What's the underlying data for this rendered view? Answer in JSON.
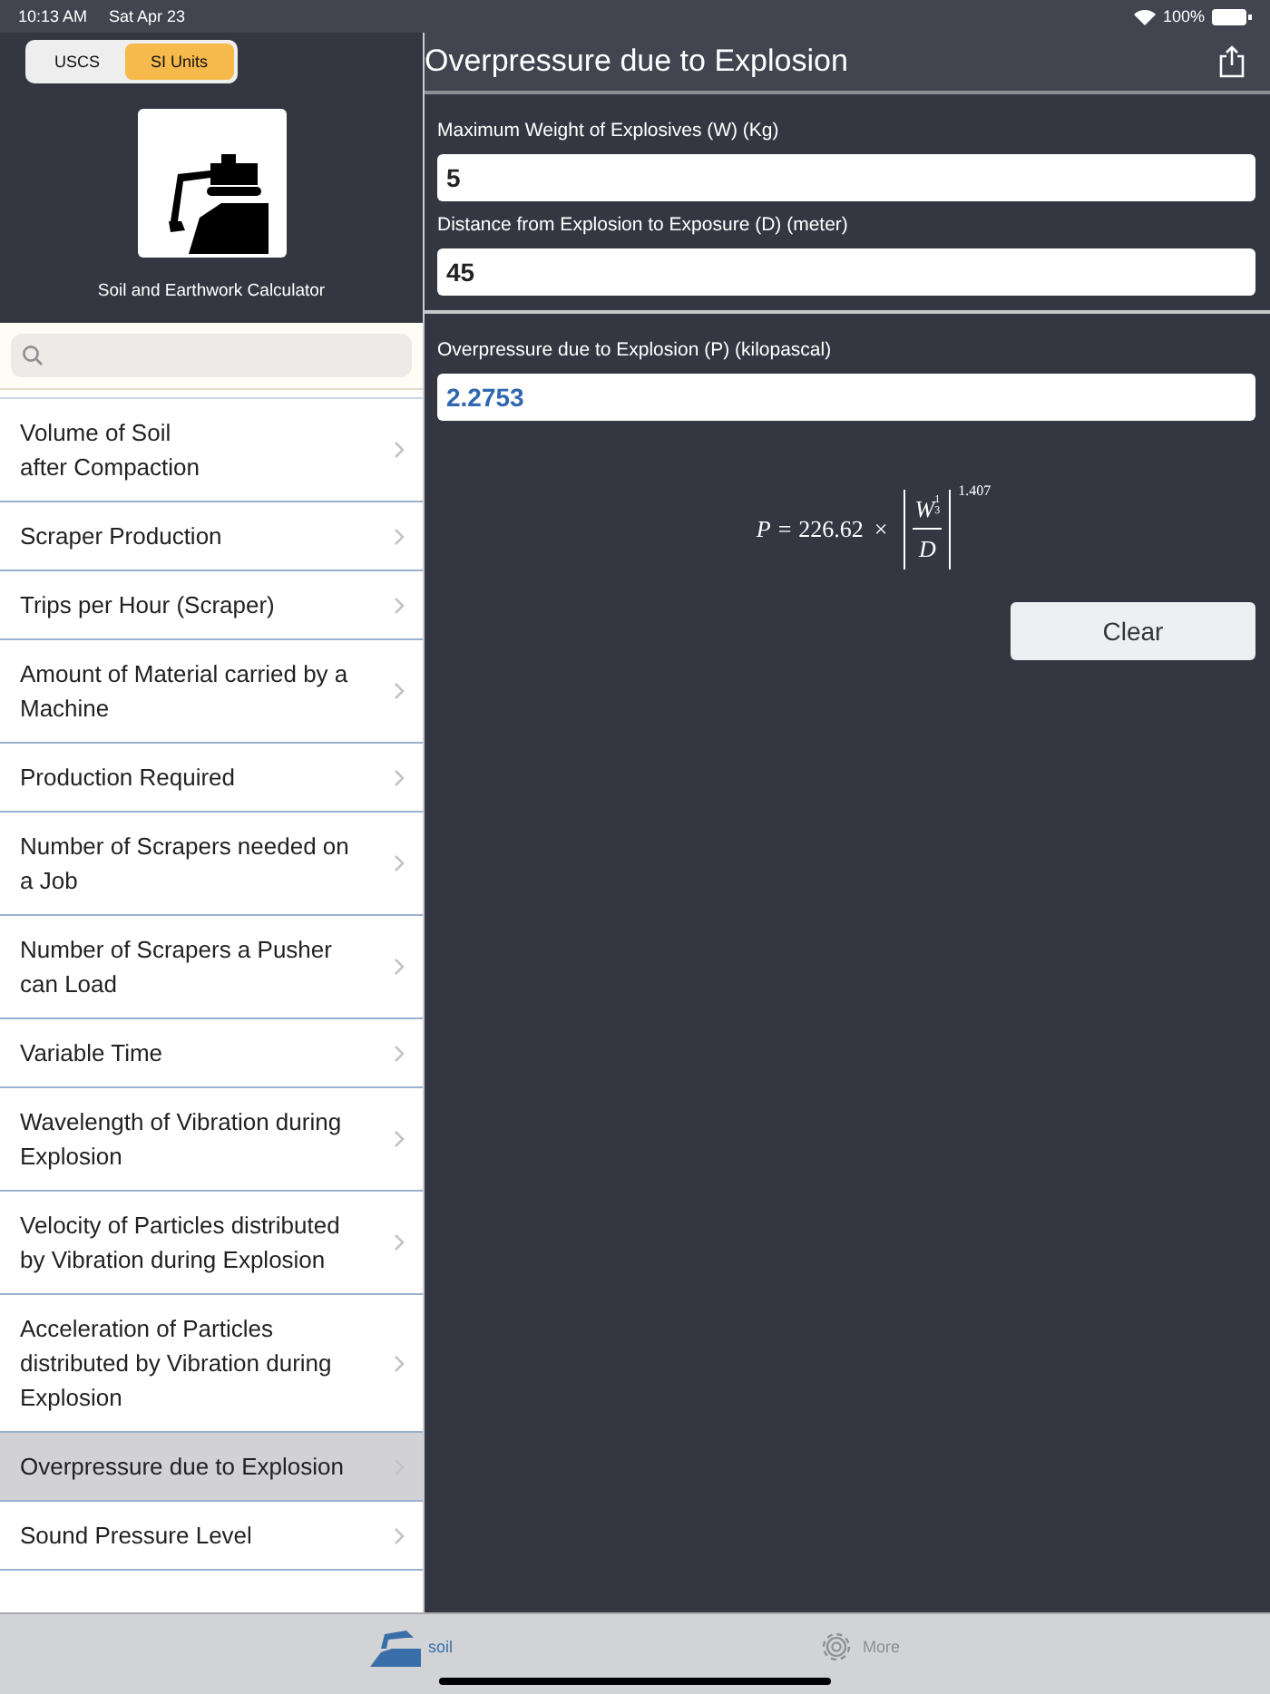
{
  "status_bar": {
    "time": "10:13 AM",
    "date": "Sat Apr 23",
    "battery_text": "100%"
  },
  "unit_toggle": [
    {
      "label": "USCS",
      "selected": false
    },
    {
      "label": "SI Units",
      "selected": true
    }
  ],
  "sidebar": {
    "app_name": "Soil and Earthwork Calculator",
    "items": [
      {
        "label": "Volume of Soil\nafter Compaction",
        "selected": false
      },
      {
        "label": "Scraper Production",
        "selected": false
      },
      {
        "label": "Trips per Hour (Scraper)",
        "selected": false
      },
      {
        "label": "Amount of Material carried by a Machine",
        "selected": false
      },
      {
        "label": "Production Required",
        "selected": false
      },
      {
        "label": "Number of Scrapers needed on a Job",
        "selected": false
      },
      {
        "label": "Number of Scrapers a Pusher can Load",
        "selected": false
      },
      {
        "label": "Variable Time",
        "selected": false
      },
      {
        "label": "Wavelength of Vibration during Explosion",
        "selected": false
      },
      {
        "label": "Velocity of Particles distributed by Vibration during Explosion",
        "selected": false
      },
      {
        "label": "Acceleration of Particles distributed by Vibration during Explosion",
        "selected": false
      },
      {
        "label": "Overpressure due to Explosion",
        "selected": true
      },
      {
        "label": "Sound Pressure Level",
        "selected": false
      }
    ]
  },
  "main": {
    "title": "Overpressure due to Explosion",
    "inputs": [
      {
        "label": "Maximum Weight of Explosives (W) (Kg)",
        "value": "5"
      },
      {
        "label": "Distance from Explosion to Exposure (D) (meter)",
        "value": "45"
      }
    ],
    "result": {
      "label": "Overpressure due to Explosion (P) (kilopascal)",
      "value": "2.2753"
    },
    "formula": {
      "lhs": "P",
      "equals": "=",
      "coef": "226.62",
      "op": "×",
      "base": "W",
      "exp_num": "1",
      "exp_den": "3",
      "den": "D",
      "power": "1.407"
    },
    "clear_button": "Clear"
  },
  "tab_bar": [
    {
      "label": "soil",
      "kind": "soil",
      "selected": true
    },
    {
      "label": "More",
      "kind": "more",
      "selected": false
    }
  ]
}
